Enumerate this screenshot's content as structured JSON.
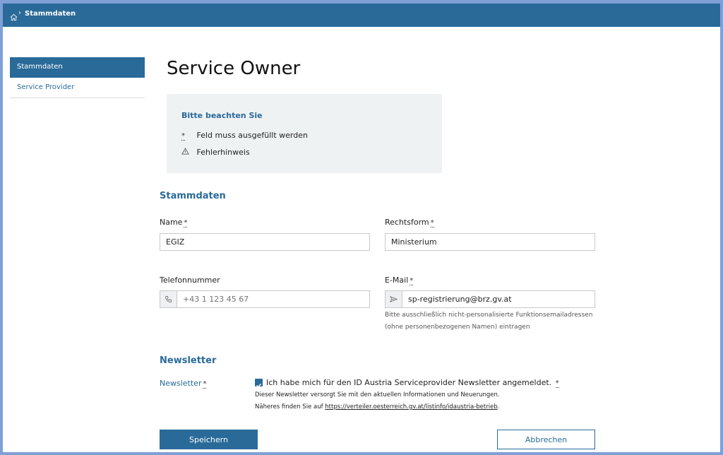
{
  "breadcrumb": {
    "home_icon": "home-icon",
    "separator": "›",
    "current": "Stammdaten"
  },
  "sidebar": {
    "items": [
      {
        "label": "Stammdaten",
        "active": true
      },
      {
        "label": "Service Provider",
        "active": false
      }
    ]
  },
  "page": {
    "title": "Service Owner"
  },
  "notice": {
    "title": "Bitte beachten Sie",
    "required_symbol": "*",
    "required_text": "Feld muss ausgefüllt werden",
    "error_icon": "warning-icon",
    "error_text": "Fehlerhinweis"
  },
  "stammdaten": {
    "section_title": "Stammdaten",
    "name_label": "Name",
    "name_value": "EGIZ",
    "rechtsform_label": "Rechtsform",
    "rechtsform_value": "Ministerium",
    "telefon_label": "Telefonnummer",
    "telefon_placeholder": "+43 1 123 45 67",
    "telefon_icon": "phone-icon",
    "email_label": "E-Mail",
    "email_value": "sp-registrierung@brz.gv.at",
    "email_icon": "send-icon",
    "email_hint": "Bitte ausschließlich nicht-personalisierte Funktionsemailadressen (ohne personenbezogenen Namen) eintragen",
    "required_mark": "*"
  },
  "newsletter": {
    "section_title": "Newsletter",
    "label": "Newsletter",
    "checkbox_text": "Ich habe mich für den ID Austria Serviceprovider Newsletter angemeldet.",
    "checked": true,
    "desc_line1": "Dieser Newsletter versorgt Sie mit den aktuellen Informationen und Neuerungen.",
    "desc_line2_prefix": "Näheres finden Sie auf ",
    "desc_link": "https://verteiler.oesterreich.gv.at/listinfo/idaustria-betrieb",
    "desc_line2_suffix": "."
  },
  "actions": {
    "save_label": "Speichern",
    "cancel_label": "Abbrechen"
  },
  "colors": {
    "brand": "#2a6a99",
    "notice_bg": "#eff2f3",
    "outer_bg": "#7f9fd6"
  }
}
